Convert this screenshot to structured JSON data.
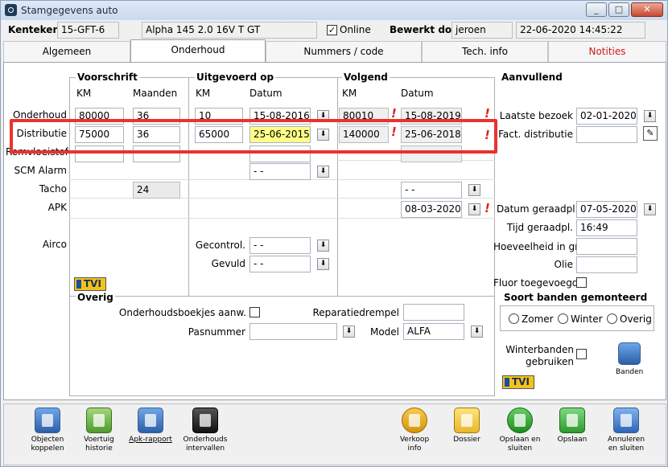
{
  "window": {
    "title": "Stamgegevens auto",
    "minimize": "_",
    "maximize": "□",
    "close": "✕"
  },
  "header": {
    "kenteken_label": "Kenteken",
    "kenteken": "15-GFT-6",
    "model": "Alpha 145 2.0 16V T GT",
    "online_label": "Online",
    "online_checked": true,
    "bewerkt_label": "Bewerkt door",
    "bewerkt_user": "jeroen",
    "bewerkt_date": "22-06-2020 14:45:22"
  },
  "tabs": [
    {
      "label": "Algemeen",
      "active": false
    },
    {
      "label": "Onderhoud",
      "active": true
    },
    {
      "label": "Nummers / code",
      "active": false
    },
    {
      "label": "Tech. info",
      "active": false
    },
    {
      "label": "Notities",
      "active": false,
      "color": "#d01818"
    }
  ],
  "sections": {
    "voorschrift": "Voorschrift",
    "uitgevoerd": "Uitgevoerd op",
    "volgend": "Volgend",
    "aanvullend": "Aanvullend",
    "col_km": "KM",
    "col_maanden": "Maanden",
    "col_datum": "Datum"
  },
  "rows": {
    "onderhoud": {
      "label": "Onderhoud",
      "v_km": "80000",
      "v_mnd": "36",
      "u_km": "10",
      "u_datum": "15-08-2016",
      "n_km": "80010",
      "n_datum": "15-08-2019"
    },
    "distributie": {
      "label": "Distributie",
      "v_km": "75000",
      "v_mnd": "36",
      "u_km": "65000",
      "u_datum": "25-06-2015",
      "n_km": "140000",
      "n_datum": "25-06-2018"
    },
    "remvloeistof": {
      "label": "Remvloeistof"
    },
    "scm": {
      "label": "SCM Alarm",
      "u_datum": "- -"
    },
    "tacho": {
      "label": "Tacho",
      "v_mnd": "24",
      "n_datum": "- -"
    },
    "apk": {
      "label": "APK",
      "n_datum": "08-03-2020"
    },
    "airco": {
      "label": "Airco"
    }
  },
  "airco": {
    "gecontrol_label": "Gecontrol.",
    "gecontrol_value": "- -",
    "gevuld_label": "Gevuld",
    "gevuld_value": "- -"
  },
  "aanvullend": {
    "laatste_bezoek_label": "Laatste bezoek",
    "laatste_bezoek": "02-01-2020",
    "fact_distributie_label": "Fact. distributie",
    "fact_distributie": "",
    "datum_geraadpl_label": "Datum geraadpl.",
    "datum_geraadpl": "07-05-2020",
    "tijd_geraadpl_label": "Tijd geraadpl.",
    "tijd_geraadpl": "16:49",
    "hoeveelheid_label": "Hoeveelheid in gr.",
    "hoeveelheid": "",
    "olie_label": "Olie",
    "olie": "",
    "fluor_label": "Fluor toegevoegd"
  },
  "overig": {
    "title": "Overig",
    "boekjes_label": "Onderhoudsboekjes aanw.",
    "reparatiedrempel_label": "Reparatiedrempel",
    "reparatiedrempel": "",
    "pasnummer_label": "Pasnummer",
    "pasnummer": "",
    "model_label": "Model",
    "model_value": "ALFA"
  },
  "banden": {
    "title": "Soort banden gemonteerd",
    "options": [
      "Zomer",
      "Winter",
      "Overig"
    ],
    "winter_label_1": "Winterbanden",
    "winter_label_2": "gebruiken",
    "banden_button": "Banden"
  },
  "tvi_logo": "TVI",
  "toolbar": [
    {
      "line1": "Objecten",
      "line2": "koppelen",
      "icon": "objecten-icon"
    },
    {
      "line1": "Voertuig",
      "line2": "historie",
      "icon": "car-icon"
    },
    {
      "line1": "Apk-rapport",
      "line2": "",
      "icon": "document-icon"
    },
    {
      "line1": "Onderhouds",
      "line2": "intervallen",
      "icon": "info-icon"
    },
    {
      "line1": "Verkoop",
      "line2": "info",
      "icon": "euro-icon"
    },
    {
      "line1": "Dossier",
      "line2": "",
      "icon": "folder-icon"
    },
    {
      "line1": "Opslaan en",
      "line2": "sluiten",
      "icon": "check-icon"
    },
    {
      "line1": "Opslaan",
      "line2": "",
      "icon": "save-icon"
    },
    {
      "line1": "Annuleren",
      "line2": "en sluiten",
      "icon": "undo-icon"
    }
  ]
}
